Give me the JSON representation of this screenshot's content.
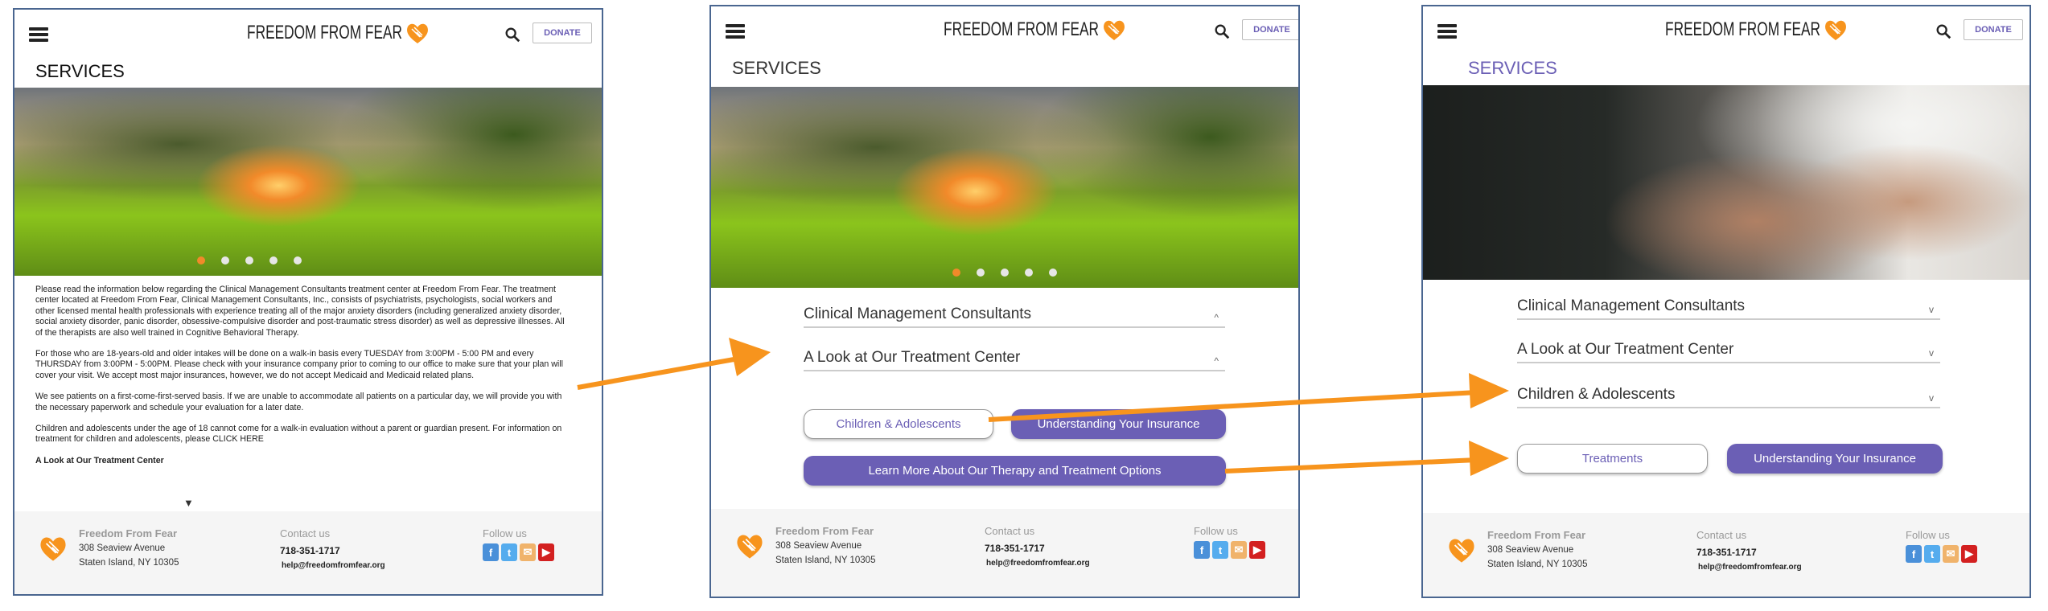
{
  "brand": {
    "name": "FREEDOM FROM FEAR",
    "accent": "#f7941d",
    "purple": "#6b5fb5"
  },
  "header": {
    "donate_label": "DONATE"
  },
  "page_title": "SERVICES",
  "panel1": {
    "paragraphs": [
      "Please read the information below regarding the Clinical Management Consultants treatment center at Freedom From Fear. The treatment center located at Freedom From Fear, Clinical Management Consultants, Inc., consists of psychiatrists, psychologists, social workers and other licensed mental health professionals with experience treating all of the major anxiety disorders (including generalized anxiety disorder, social anxiety disorder, panic disorder, obsessive-compulsive disorder and post-traumatic stress disorder) as well as depressive illnesses. All of the therapists are also well trained in Cognitive Behavioral Therapy.",
      "For those who are 18-years-old and older intakes will be done on a walk-in basis every TUESDAY from 3:00PM - 5:00 PM and every THURSDAY from 3:00PM - 5:00PM.  Please check with your insurance company prior to coming to our office to make sure that your plan will cover your visit.  We accept most major insurances, however, we do not accept Medicaid and Medicaid related plans.",
      "We see patients on a first-come-first-served basis. If we are unable to accommodate all patients on a particular day, we will provide you with the necessary paperwork and schedule your evaluation for a later date.",
      "Children and adolescents under the age of 18 cannot come for a walk-in evaluation without a parent or guardian present. For information on treatment for children and adolescents, please CLICK HERE"
    ],
    "section_heading": "A Look at Our Treatment Center",
    "expand_glyph": "▼"
  },
  "panel2": {
    "accordions": [
      {
        "label": "Clinical Management Consultants",
        "chevron": "^"
      },
      {
        "label": "A Look at Our Treatment Center",
        "chevron": "^"
      }
    ],
    "buttons": {
      "children": "Children & Adolescents",
      "insurance": "Understanding Your Insurance",
      "learn_more": "Learn More About Our Therapy and Treatment Options"
    }
  },
  "panel3": {
    "accordions": [
      {
        "label": "Clinical Management Consultants",
        "chevron": "v"
      },
      {
        "label": "A Look at Our Treatment Center",
        "chevron": "v"
      },
      {
        "label": "Children & Adolescents",
        "chevron": "v"
      }
    ],
    "buttons": {
      "treatments": "Treatments",
      "insurance": "Understanding Your Insurance"
    }
  },
  "footer": {
    "org_name": "Freedom From Fear",
    "address_line1": "308 Seaview Avenue",
    "address_line2": "Staten Island, NY 10305",
    "contact_heading": "Contact us",
    "phone": "718-351-1717",
    "email": "help@freedomfromfear.org",
    "follow_heading": "Follow us",
    "social": [
      {
        "icon": "facebook-icon",
        "glyph": "f",
        "color": "#4a90d9"
      },
      {
        "icon": "twitter-icon",
        "glyph": "t",
        "color": "#55acee"
      },
      {
        "icon": "email-icon",
        "glyph": "✉",
        "color": "#f0b36b"
      },
      {
        "icon": "youtube-icon",
        "glyph": "▶",
        "color": "#d32020"
      }
    ]
  }
}
